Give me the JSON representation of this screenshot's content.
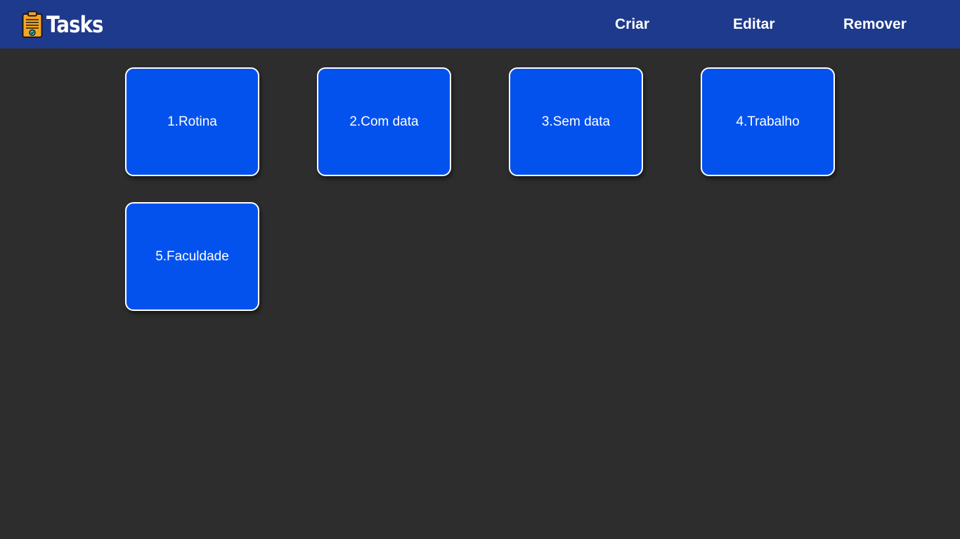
{
  "header": {
    "brand": {
      "name": "Tasks",
      "icon": "clipboard-check-icon"
    },
    "nav": [
      {
        "label": "Criar"
      },
      {
        "label": "Editar"
      },
      {
        "label": "Remover"
      }
    ]
  },
  "lists": [
    {
      "label": "1.Rotina"
    },
    {
      "label": "2.Com data"
    },
    {
      "label": "3.Sem data"
    },
    {
      "label": "4.Trabalho"
    },
    {
      "label": "5.Faculdade"
    }
  ],
  "colors": {
    "navbar": "#1e3a8c",
    "background": "#2d2d2d",
    "card": "#0452ee",
    "card_border": "#ffffff",
    "icon_body": "#f5a623",
    "icon_check": "#2ec4b6"
  }
}
